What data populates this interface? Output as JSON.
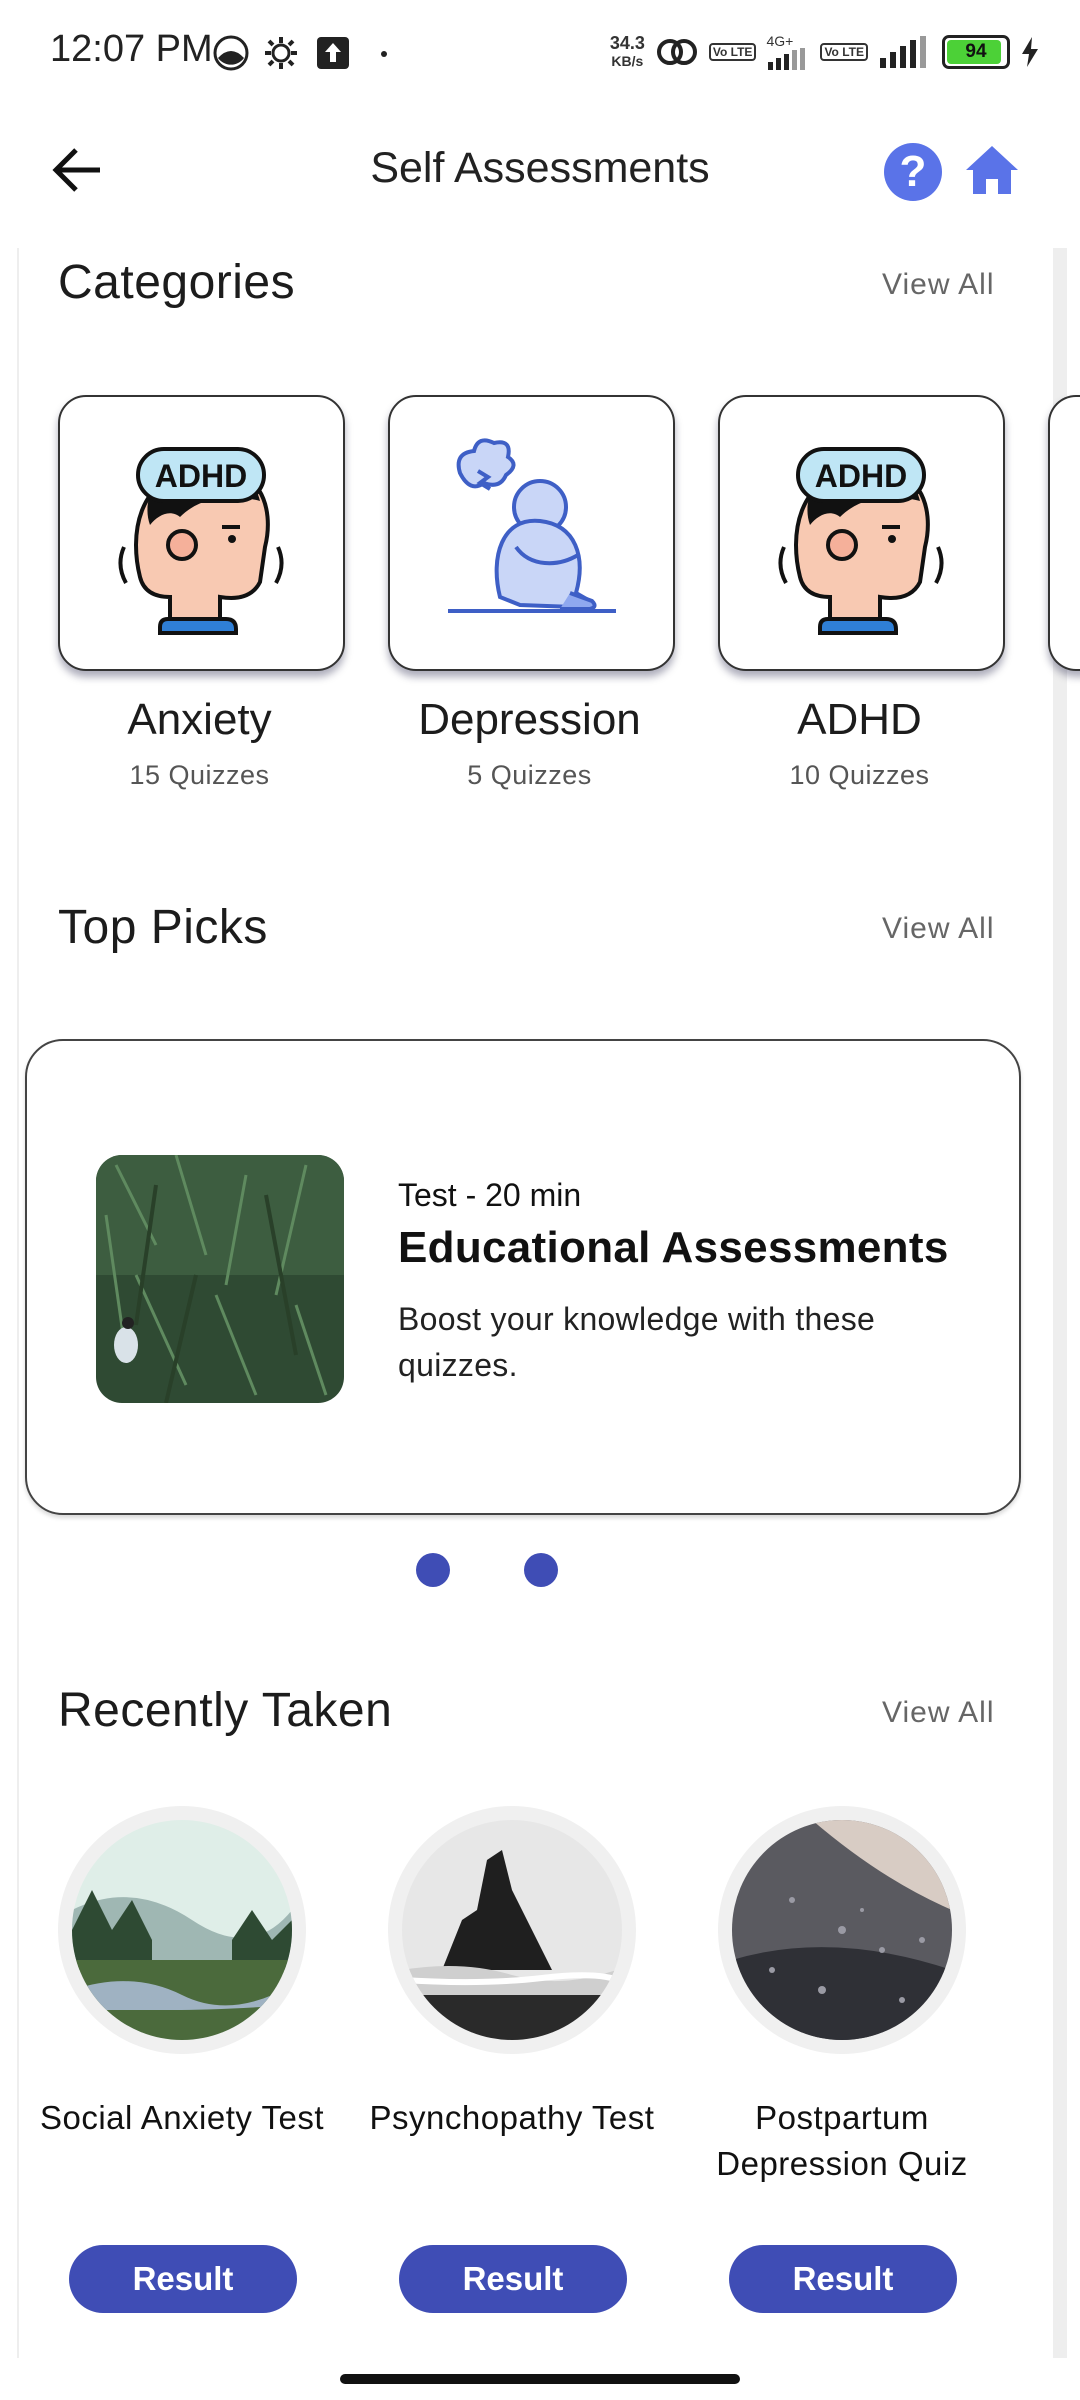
{
  "status_bar": {
    "time": "12:07 PM",
    "net_speed_value": "34.3",
    "net_speed_unit": "KB/s",
    "network_label": "4G+",
    "volte_label": "Vo LTE",
    "battery_percent": "94",
    "battery_level": 0.94
  },
  "header": {
    "title": "Self Assessments",
    "help_symbol": "?",
    "back_icon": "arrow-left-icon",
    "home_icon": "home-icon"
  },
  "categories": {
    "title": "Categories",
    "view_all": "View All",
    "items": [
      {
        "name": "Anxiety",
        "count": "15 Quizzes",
        "icon": "adhd-head-icon",
        "icon_text": "ADHD"
      },
      {
        "name": "Depression",
        "count": "5 Quizzes",
        "icon": "sad-person-icon"
      },
      {
        "name": "ADHD",
        "count": "10 Quizzes",
        "icon": "adhd-head-icon",
        "icon_text": "ADHD"
      }
    ]
  },
  "top_picks": {
    "title": "Top Picks",
    "view_all": "View All",
    "card": {
      "meta": "Test - 20 min",
      "title": "Educational Assessments",
      "description": "Boost your knowledge with these quizzes."
    },
    "page_count": 2
  },
  "recently_taken": {
    "title": "Recently Taken",
    "view_all": "View All",
    "items": [
      {
        "name": "Social Anxiety Test",
        "button": "Result"
      },
      {
        "name": "Psynchopathy Test",
        "button": "Result"
      },
      {
        "name": "Postpartum Depression Quiz",
        "button": "Result"
      }
    ]
  },
  "colors": {
    "primary": "#3f4db5",
    "accent_icon": "#5a73e8",
    "battery_green": "#4cd137"
  }
}
